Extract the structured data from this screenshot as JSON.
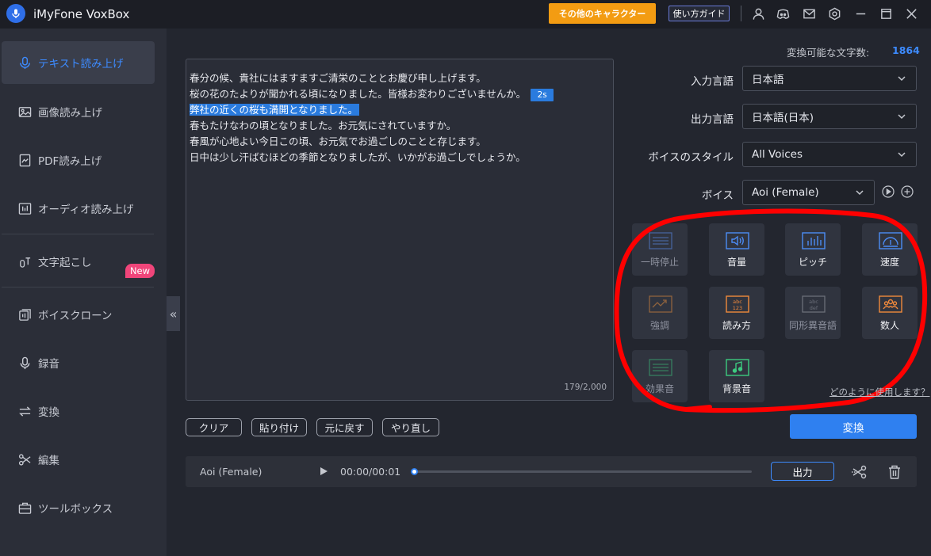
{
  "app": {
    "title": "iMyFone VoxBox"
  },
  "titlebar": {
    "other_characters_label": "その他のキャラクター",
    "guide_label": "使い方ガイド",
    "icons": [
      "user-icon",
      "discord-icon",
      "mail-icon",
      "settings-icon",
      "minimize-icon",
      "maximize-icon",
      "close-icon"
    ]
  },
  "sidebar": {
    "items": [
      {
        "label": "テキスト読み上げ",
        "icon": "mic-icon",
        "active": true
      },
      {
        "label": "画像読み上げ",
        "icon": "image-icon"
      },
      {
        "label": "PDF読み上げ",
        "icon": "pdf-icon"
      },
      {
        "label": "オーディオ読み上げ",
        "icon": "audio-icon"
      },
      {
        "label": "文字起こし",
        "icon": "transcribe-icon"
      },
      {
        "label": "ボイスクローン",
        "icon": "clone-icon"
      },
      {
        "label": "録音",
        "icon": "record-icon"
      },
      {
        "label": "変換",
        "icon": "convert-icon"
      },
      {
        "label": "編集",
        "icon": "scissors-icon"
      },
      {
        "label": "ツールボックス",
        "icon": "toolbox-icon"
      }
    ],
    "new_badge": "New",
    "collapse_glyph": "«"
  },
  "editor": {
    "lines": [
      "春分の候、貴社にはますますご清栄のこととお慶び申し上げます。",
      "桜の花のたよりが聞かれる頃になりました。皆様お変わりございませんか。",
      "弊社の近くの桜も満開となりました。",
      "春もたけなわの頃となりました。お元気にされていますか。",
      "春風が心地よい今日この頃、お元気でお過ごしのことと存じます。",
      "日中は少し汗ばむほどの季節となりましたが、いかがお過ごしでしょうか。"
    ],
    "pause_tag": "2s",
    "char_counter": "179/2,000"
  },
  "edit_buttons": {
    "clear": "クリア",
    "paste": "貼り付け",
    "undo": "元に戻す",
    "redo": "やり直し"
  },
  "panel": {
    "char_count_label": "変換可能な文字数:",
    "char_count_value": "1864",
    "input_language_label": "入力言語",
    "input_language_value": "日本語",
    "output_language_label": "出力言語",
    "output_language_value": "日本語(日本)",
    "voice_style_label": "ボイスのスタイル",
    "voice_style_value": "All Voices",
    "voice_label": "ボイス",
    "voice_value": "Aoi (Female)",
    "tiles": [
      {
        "label": "一時停止",
        "icon": "pause-icon",
        "enabled": false
      },
      {
        "label": "音量",
        "icon": "volume-icon",
        "enabled": true
      },
      {
        "label": "ピッチ",
        "icon": "pitch-icon",
        "enabled": true
      },
      {
        "label": "速度",
        "icon": "speed-icon",
        "enabled": true
      },
      {
        "label": "強調",
        "icon": "emphasis-icon",
        "enabled": false
      },
      {
        "label": "読み方",
        "icon": "reading-icon",
        "enabled": true
      },
      {
        "label": "同形異音語",
        "icon": "homograph-icon",
        "enabled": false
      },
      {
        "label": "数人",
        "icon": "multi-voice-icon",
        "enabled": true
      },
      {
        "label": "効果音",
        "icon": "sound-effect-icon",
        "enabled": false
      },
      {
        "label": "背景音",
        "icon": "music-icon",
        "enabled": true
      }
    ],
    "how_to_link": "どのように使用します？",
    "convert_label": "変換"
  },
  "player": {
    "voice": "Aoi (Female)",
    "time": "00:00/00:01",
    "progress": 0,
    "export_label": "出力"
  },
  "colors": {
    "accent": "#2f80f0",
    "orange": "#f39c12",
    "annotation": "#ff0000"
  }
}
